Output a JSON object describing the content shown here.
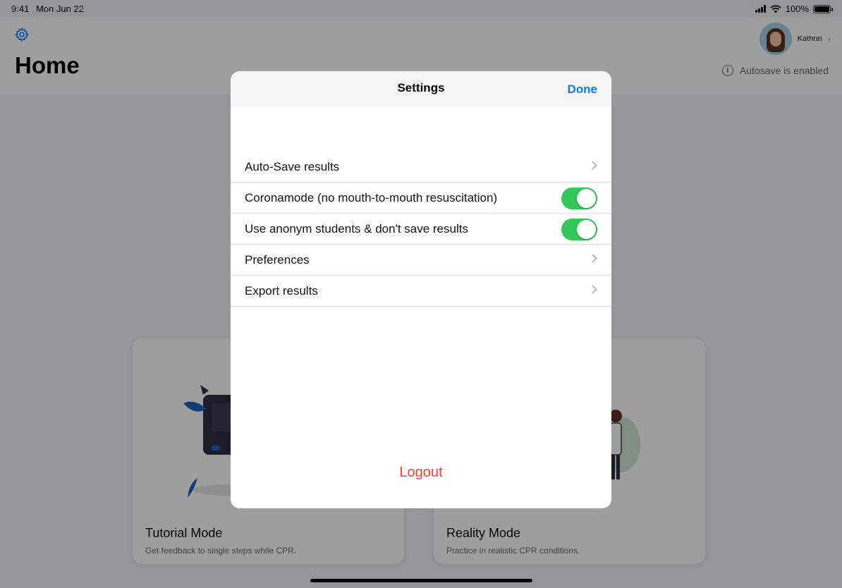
{
  "status_bar": {
    "time": "9:41",
    "date": "Mon Jun 22",
    "battery": "100%",
    "battery_level": 1.0
  },
  "header": {
    "title": "Home",
    "user_name": "Kathrin",
    "autosave_text": "Autosave is enabled"
  },
  "cards": [
    {
      "title": "Tutorial Mode",
      "subtitle": "Get feedback to single steps while CPR."
    },
    {
      "title": "Reality Mode",
      "subtitle": "Practice in realistic CPR conditions."
    }
  ],
  "modal": {
    "title": "Settings",
    "done_label": "Done",
    "rows": [
      {
        "label": "Auto-Save results",
        "type": "chevron"
      },
      {
        "label": "Coronamode (no mouth-to-mouth resuscitation)",
        "type": "toggle",
        "on": true
      },
      {
        "label": "Use anonym students & don't save results",
        "type": "toggle",
        "on": true
      },
      {
        "label": "Preferences",
        "type": "chevron"
      },
      {
        "label": "Export results",
        "type": "chevron"
      }
    ],
    "logout_label": "Logout"
  },
  "colors": {
    "accent": "#0a7aff",
    "toggle_on": "#34c759",
    "destructive": "#ff3b30"
  }
}
